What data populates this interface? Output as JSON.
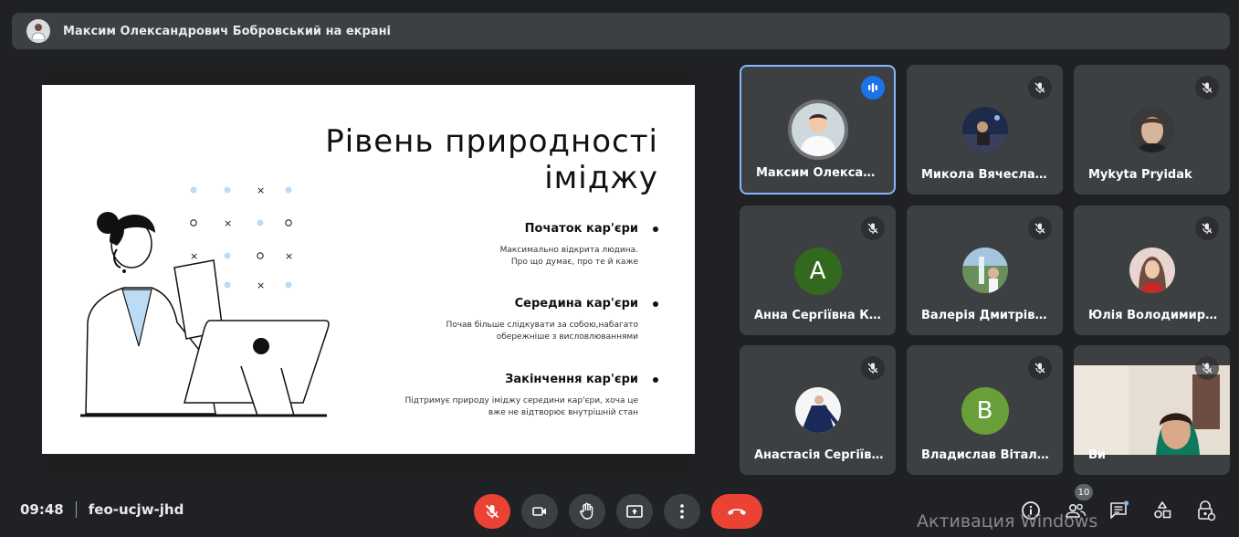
{
  "presenter_banner": {
    "text": "Максим Олександрович Бобровський на екрані"
  },
  "slide": {
    "title_line1": "Рівень  природності",
    "title_line2": "іміджу",
    "items": [
      {
        "heading": "Початок кар'єри",
        "desc_line1": "Максимально відкрита людина.",
        "desc_line2": "Про що думає, про те й каже"
      },
      {
        "heading": "Середина кар'єри",
        "desc_line1": "Почав більше слідкувати за собою,набагато",
        "desc_line2": "обережніше з висловлюваннями"
      },
      {
        "heading": "Закінчення кар'єри",
        "desc_line1": "Підтримує природу іміджу середини кар'єри, хоча це",
        "desc_line2": "вже не відтворює внутрішній стан"
      }
    ]
  },
  "participants": [
    {
      "name": "Максим Олександ…",
      "avatar": "photo",
      "speaking": true
    },
    {
      "name": "Микола Вячеслав…",
      "avatar": "photo",
      "muted": true
    },
    {
      "name": "Mykyta Pryidak",
      "avatar": "photo",
      "muted": true
    },
    {
      "name": "Анна Сергіївна Ко…",
      "avatar_letter": "A",
      "avatar_color": "#33691e",
      "muted": true
    },
    {
      "name": "Валерія Дмитрівн…",
      "avatar": "photo",
      "muted": true
    },
    {
      "name": "Юлія Володимирі…",
      "avatar": "photo",
      "muted": true
    },
    {
      "name": "Анастасія Сергіївн…",
      "avatar": "photo",
      "muted": true
    },
    {
      "name": "Владислав Віталій…",
      "avatar_letter": "B",
      "avatar_color": "#689f38",
      "muted": true
    },
    {
      "name": "Ви",
      "avatar": "camera",
      "muted": true
    }
  ],
  "meeting": {
    "time": "09:48",
    "code": "feo-ucjw-jhd"
  },
  "people_count": "10",
  "watermark": "Активация Windows",
  "icons": {
    "controls": [
      "mic-off-icon",
      "camera-icon",
      "raise-hand-icon",
      "present-icon",
      "more-icon",
      "end-call-icon"
    ],
    "right": [
      "info-icon",
      "people-icon",
      "chat-icon",
      "activities-icon",
      "host-controls-icon"
    ]
  },
  "colors": {
    "background": "#202124",
    "tile": "#3c4043",
    "active_border": "#8ab4f8",
    "end_call": "#ea4335",
    "speaking": "#1a73e8"
  }
}
